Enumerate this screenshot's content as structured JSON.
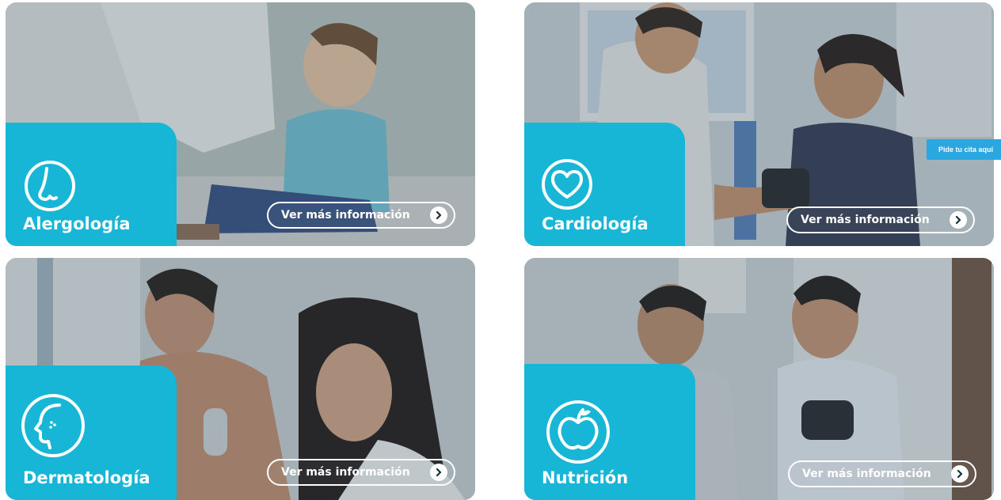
{
  "cards": [
    {
      "title": "Alergología",
      "button_label": "Ver más información",
      "icon": "nose-icon"
    },
    {
      "title": "Cardiología",
      "button_label": "Ver más información",
      "icon": "heart-icon"
    },
    {
      "title": "Dermatología",
      "button_label": "Ver más información",
      "icon": "face-profile-icon"
    },
    {
      "title": "Nutrición",
      "button_label": "Ver más información",
      "icon": "apple-icon"
    }
  ],
  "floating_tab": {
    "label": "Pide tu cita aquí"
  },
  "colors": {
    "badge": "#17b6d6",
    "floating_tab": "#2aa6e0",
    "button_border": "#ffffff"
  }
}
